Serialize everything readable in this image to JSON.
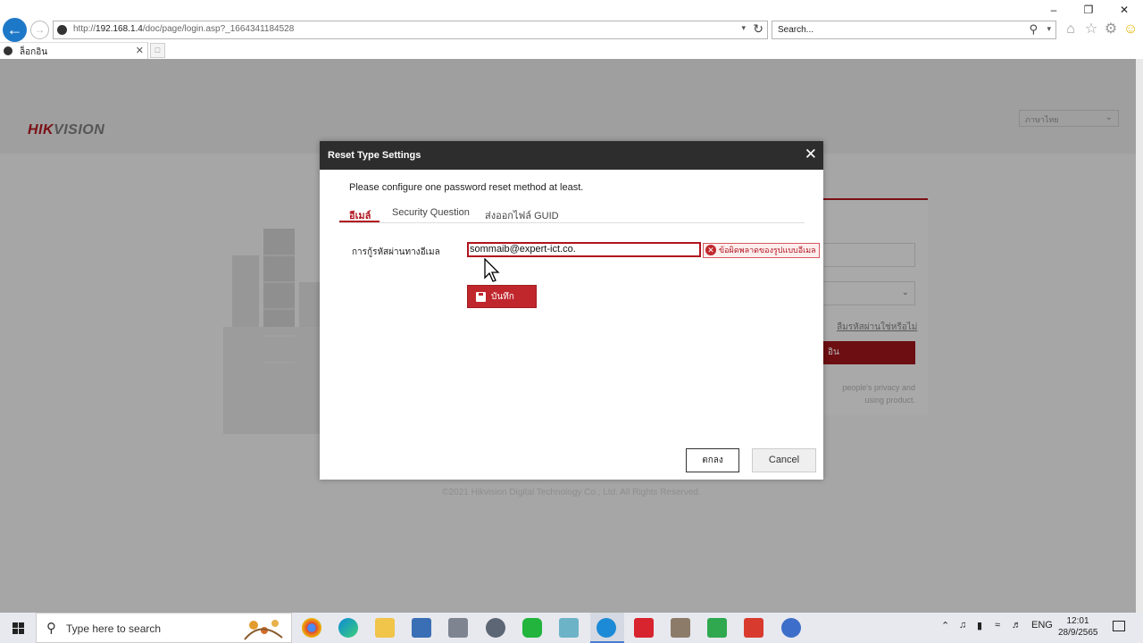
{
  "browser": {
    "url_prefix": "http://",
    "url_host": "192.168.1.4",
    "url_path": "/doc/page/login.asp?_1664341184528",
    "search_placeholder": "Search...",
    "tab_title": "ล็อกอิน"
  },
  "page": {
    "logo_main": "HIK",
    "logo_rest": "VISION",
    "language": "ภาษาไทย",
    "forgot_password": "ลืมรหัสผ่านใช่หรือไม่",
    "login_button": "อิน",
    "privacy_note_1": "people's privacy and",
    "privacy_note_2": "using product.",
    "copyright": "©2021 Hikvision Digital Technology Co., Ltd. All Rights Reserved."
  },
  "dialog": {
    "title": "Reset Type Settings",
    "info": "Please configure one password reset method at least.",
    "tabs": [
      {
        "label": "อีเมล์"
      },
      {
        "label": "Security Question"
      },
      {
        "label": "ส่งออกไฟล์ GUID"
      }
    ],
    "email_label": "การกู้รหัสผ่านทางอีเมล",
    "email_value": "sommaib@expert-ict.co.",
    "email_error": "ข้อผิดพลาดของรูปแบบอีเมล",
    "save_label": "บันทึก",
    "ok_label": "ตกลง",
    "cancel_label": "Cancel"
  },
  "taskbar": {
    "search_placeholder": "Type here to search",
    "lang": "ENG",
    "time": "12:01",
    "date": "28/9/2565"
  },
  "colors": {
    "accent": "#c0272d",
    "dialog_header": "#2d2d2d",
    "overlay": "#a6a6a6"
  }
}
